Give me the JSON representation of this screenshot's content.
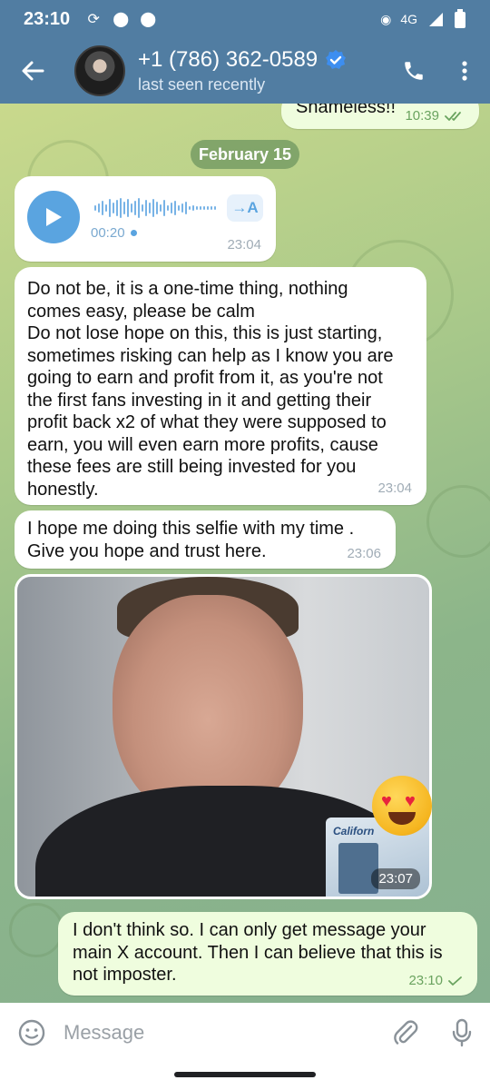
{
  "status_bar": {
    "time": "23:10",
    "network": "4G",
    "icons": [
      "sync-icon",
      "location-icon",
      "location-icon",
      "hotspot-icon",
      "signal-icon",
      "battery-icon"
    ]
  },
  "header": {
    "contact_name": "+1 (786) 362-0589",
    "status": "last seen recently",
    "verified_icon": "verified-badge-icon",
    "colors": {
      "bar": "#517da2",
      "verified": "#3d8ef0"
    }
  },
  "chat": {
    "top_outgoing": {
      "text": "Shameless!!",
      "time": "10:39"
    },
    "date_separator": "February 15",
    "voice_message": {
      "duration": "00:20",
      "transcribe_label": "→A",
      "time": "23:04"
    },
    "messages": [
      {
        "lines": [
          "Do not be, it is a one-time thing, nothing",
          "comes easy, please be calm",
          "Do not lose hope on this, this is just starting,",
          "sometimes risking can help as I know you are",
          "going to earn and profit from it, as you're not",
          "the first fans investing in it and getting their",
          "profit back x2 of what they were supposed to",
          "earn, you will even earn more profits, cause",
          "these fees are still being invested for you",
          "honestly."
        ],
        "time": "23:04"
      },
      {
        "lines": [
          "I hope me doing this selfie with my time .",
          "Give you hope and trust here."
        ],
        "time": "23:06"
      }
    ],
    "photo": {
      "time": "23:07",
      "card_label": "Californ",
      "reaction": "heart-eyes-emoji"
    },
    "last_outgoing": {
      "lines": [
        "I don't think so. I can only get message your",
        "main X account. Then I can believe that this is",
        "not imposter."
      ],
      "time": "23:10"
    }
  },
  "composer": {
    "placeholder": "Message"
  }
}
